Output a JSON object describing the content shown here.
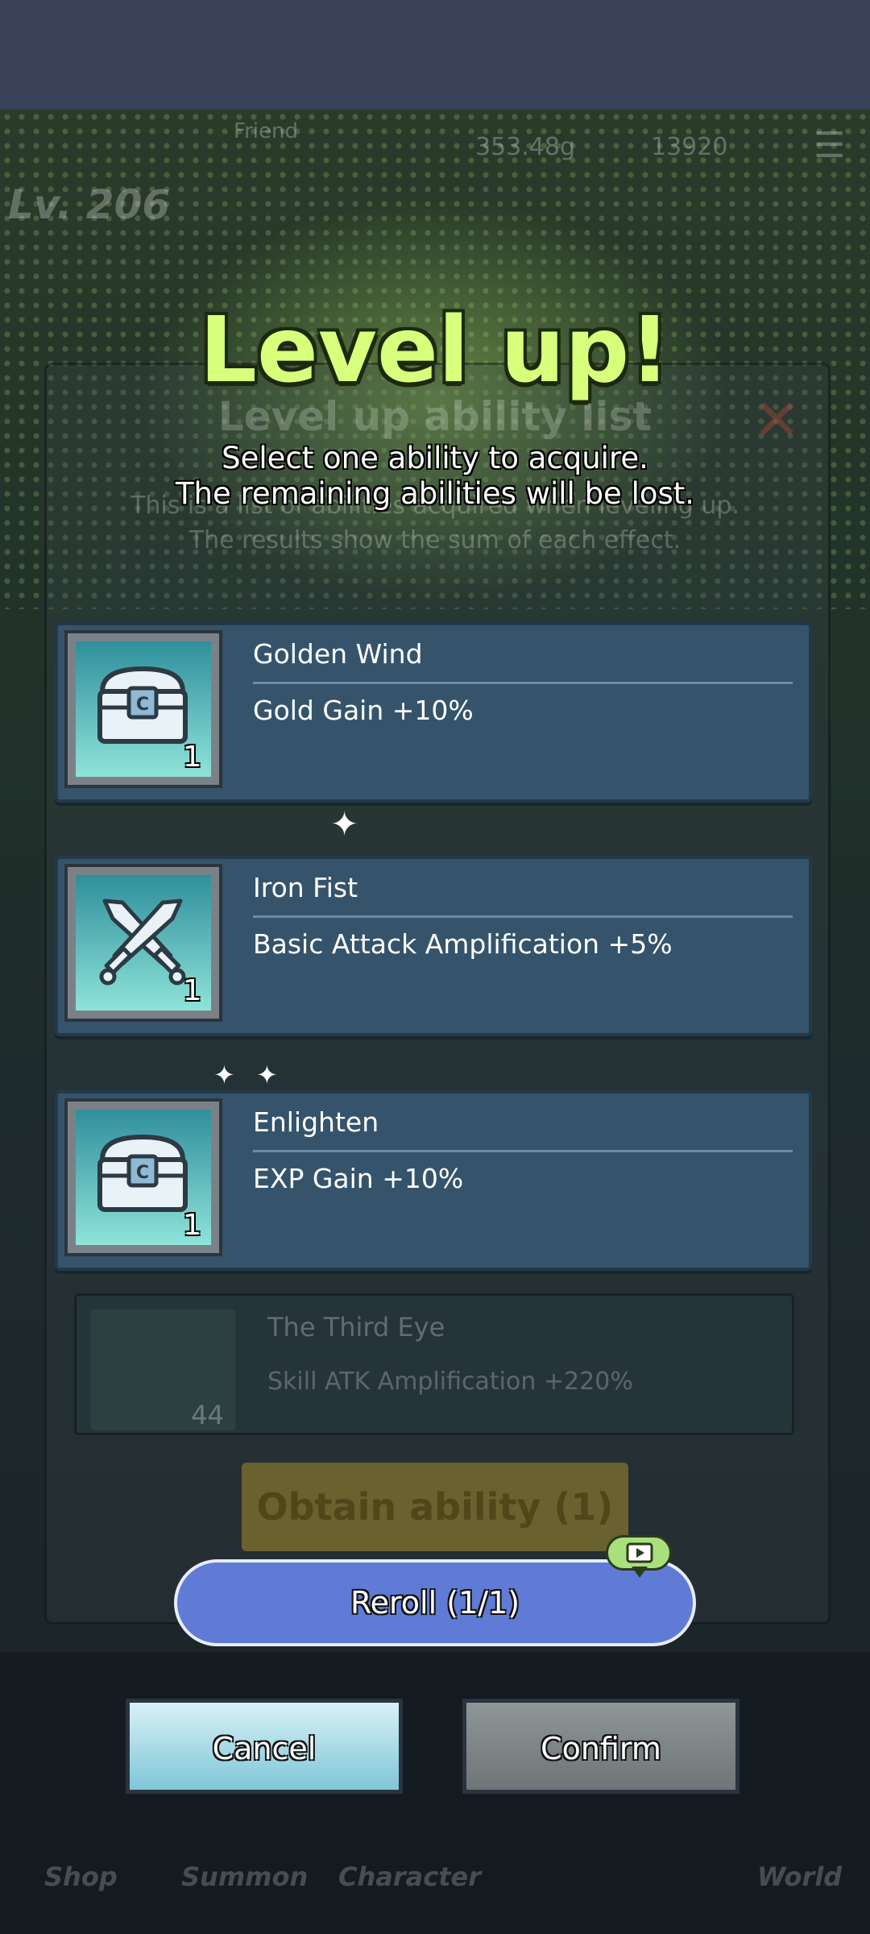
{
  "dialog": {
    "title": "Level up!",
    "subtitle_line1": "Select one ability to acquire.",
    "subtitle_line2": "The remaining abilities will be lost."
  },
  "abilities": [
    {
      "name": "Golden Wind",
      "effect": "Gold Gain +10%",
      "count": "1",
      "icon": "treasure-chest-icon"
    },
    {
      "name": "Iron Fist",
      "effect": "Basic Attack Amplification +5%",
      "count": "1",
      "icon": "crossed-swords-icon"
    },
    {
      "name": "Enlighten",
      "effect": "EXP Gain +10%",
      "count": "1",
      "icon": "treasure-chest-icon"
    }
  ],
  "buttons": {
    "reroll": "Reroll (1/1)",
    "cancel": "Cancel",
    "confirm": "Confirm"
  },
  "background": {
    "level": "Lv. 206",
    "friend": "Friend",
    "currency_gold": "353.48g",
    "currency_gems": "13920",
    "panel_title": "Level up ability list",
    "panel_desc1": "This is a list of abilities acquired when leveling up.",
    "panel_desc2": "The results show the sum of each effect.",
    "list_card_name": "The Third Eye",
    "list_card_effect": "Skill ATK Amplification +220%",
    "list_card_count": "44",
    "obtain_button": "Obtain ability (1)",
    "nav": [
      "Shop",
      "Summon",
      "Character",
      "World"
    ]
  },
  "colors": {
    "title": "#d8ff7c",
    "card_bg": "#35546b",
    "reroll_bg": "#5f7bd6",
    "cancel_bg": "#9fd8e6",
    "confirm_bg": "#7d8587"
  }
}
